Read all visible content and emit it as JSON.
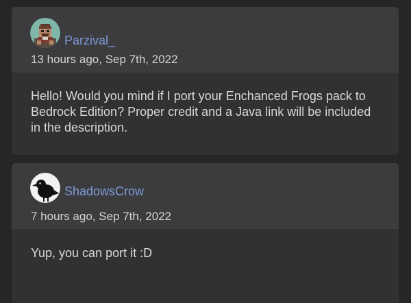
{
  "comments": [
    {
      "author": "Parzival_",
      "avatar_icon": "pixel-character-avatar-icon",
      "timestamp": "13 hours ago, Sep 7th, 2022",
      "body": "Hello! Would you mind if I port your Enchanced Frogs pack to Bedrock Edition? Proper credit and a Java link will be included in the description."
    },
    {
      "author": "ShadowsCrow",
      "avatar_icon": "crow-avatar-icon",
      "timestamp": "7 hours ago, Sep 7th, 2022",
      "body": "Yup, you can port it :D"
    }
  ],
  "colors": {
    "background": "#262626",
    "card_header": "#3c3c3f",
    "card_body": "#313133",
    "username": "#7d9ad8",
    "text": "#d9d9d9"
  }
}
